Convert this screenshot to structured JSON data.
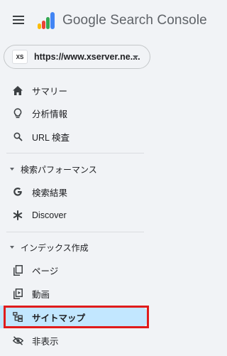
{
  "app": {
    "title": "Google Search Console"
  },
  "property": {
    "badge": "XS",
    "url": "https://www.xserver.ne...."
  },
  "nav": {
    "top": [
      {
        "label": "サマリー",
        "icon": "home-icon"
      },
      {
        "label": "分析情報",
        "icon": "lightbulb-icon"
      },
      {
        "label": "URL 検査",
        "icon": "search-icon"
      }
    ],
    "search_section": {
      "title": "検索パフォーマンス",
      "items": [
        {
          "label": "検索結果",
          "icon": "google-g-icon"
        },
        {
          "label": "Discover",
          "icon": "asterisk-icon"
        }
      ]
    },
    "index_section": {
      "title": "インデックス作成",
      "items": [
        {
          "label": "ページ",
          "icon": "pages-icon"
        },
        {
          "label": "動画",
          "icon": "video-icon"
        },
        {
          "label": "サイトマップ",
          "icon": "sitemap-icon",
          "selected": true
        },
        {
          "label": "非表示",
          "icon": "visibility-off-icon"
        }
      ]
    }
  },
  "colors": {
    "selected_bg": "#c2e7ff",
    "highlight_border": "#e01c1c",
    "sidebar_bg": "#f1f3f6"
  }
}
